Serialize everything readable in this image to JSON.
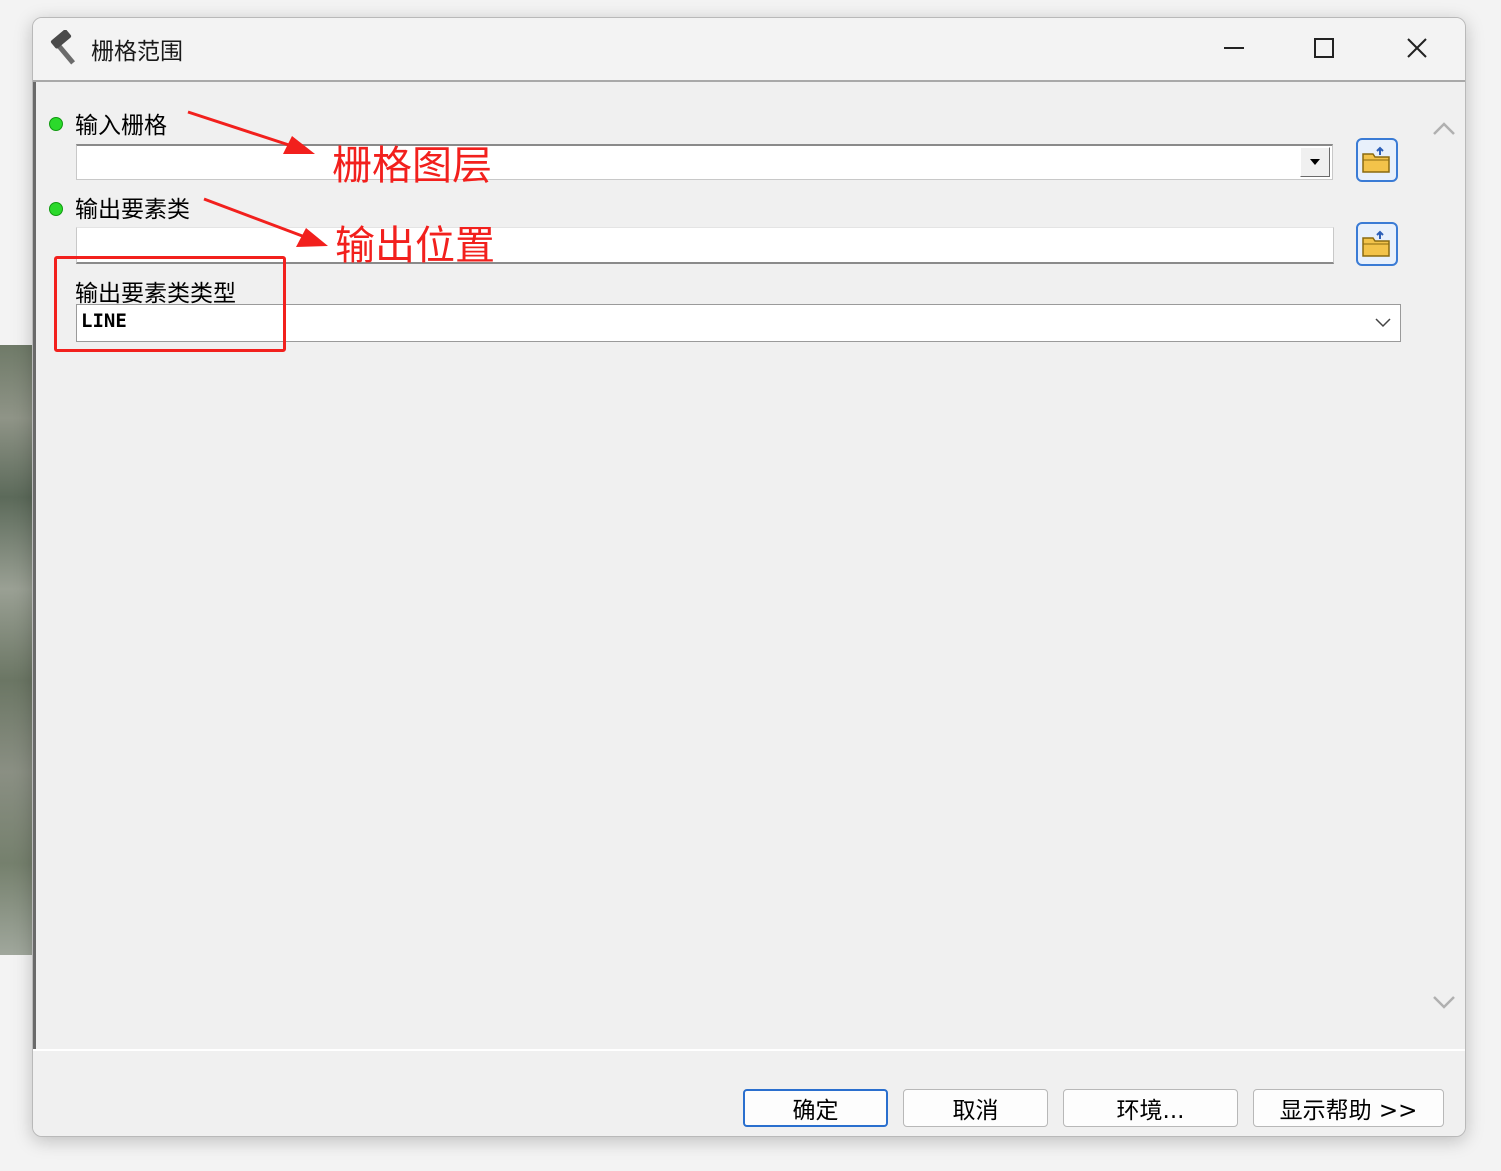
{
  "window": {
    "title": "栅格范围"
  },
  "params": [
    {
      "label": "输入栅格",
      "required": true,
      "value": ""
    },
    {
      "label": "输出要素类",
      "required": true,
      "value": ""
    },
    {
      "label": "输出要素类类型",
      "required": false,
      "value": "LINE"
    }
  ],
  "buttons": {
    "ok": "确定",
    "cancel": "取消",
    "env": "环境...",
    "help": "显示帮助 >>"
  },
  "annotations": {
    "raster_layer": "栅格图层",
    "output_location": "输出位置"
  },
  "colors": {
    "annotation_red": "#f2201d",
    "required_dot": "#2bd92b",
    "primary_border": "#2a6fce"
  }
}
